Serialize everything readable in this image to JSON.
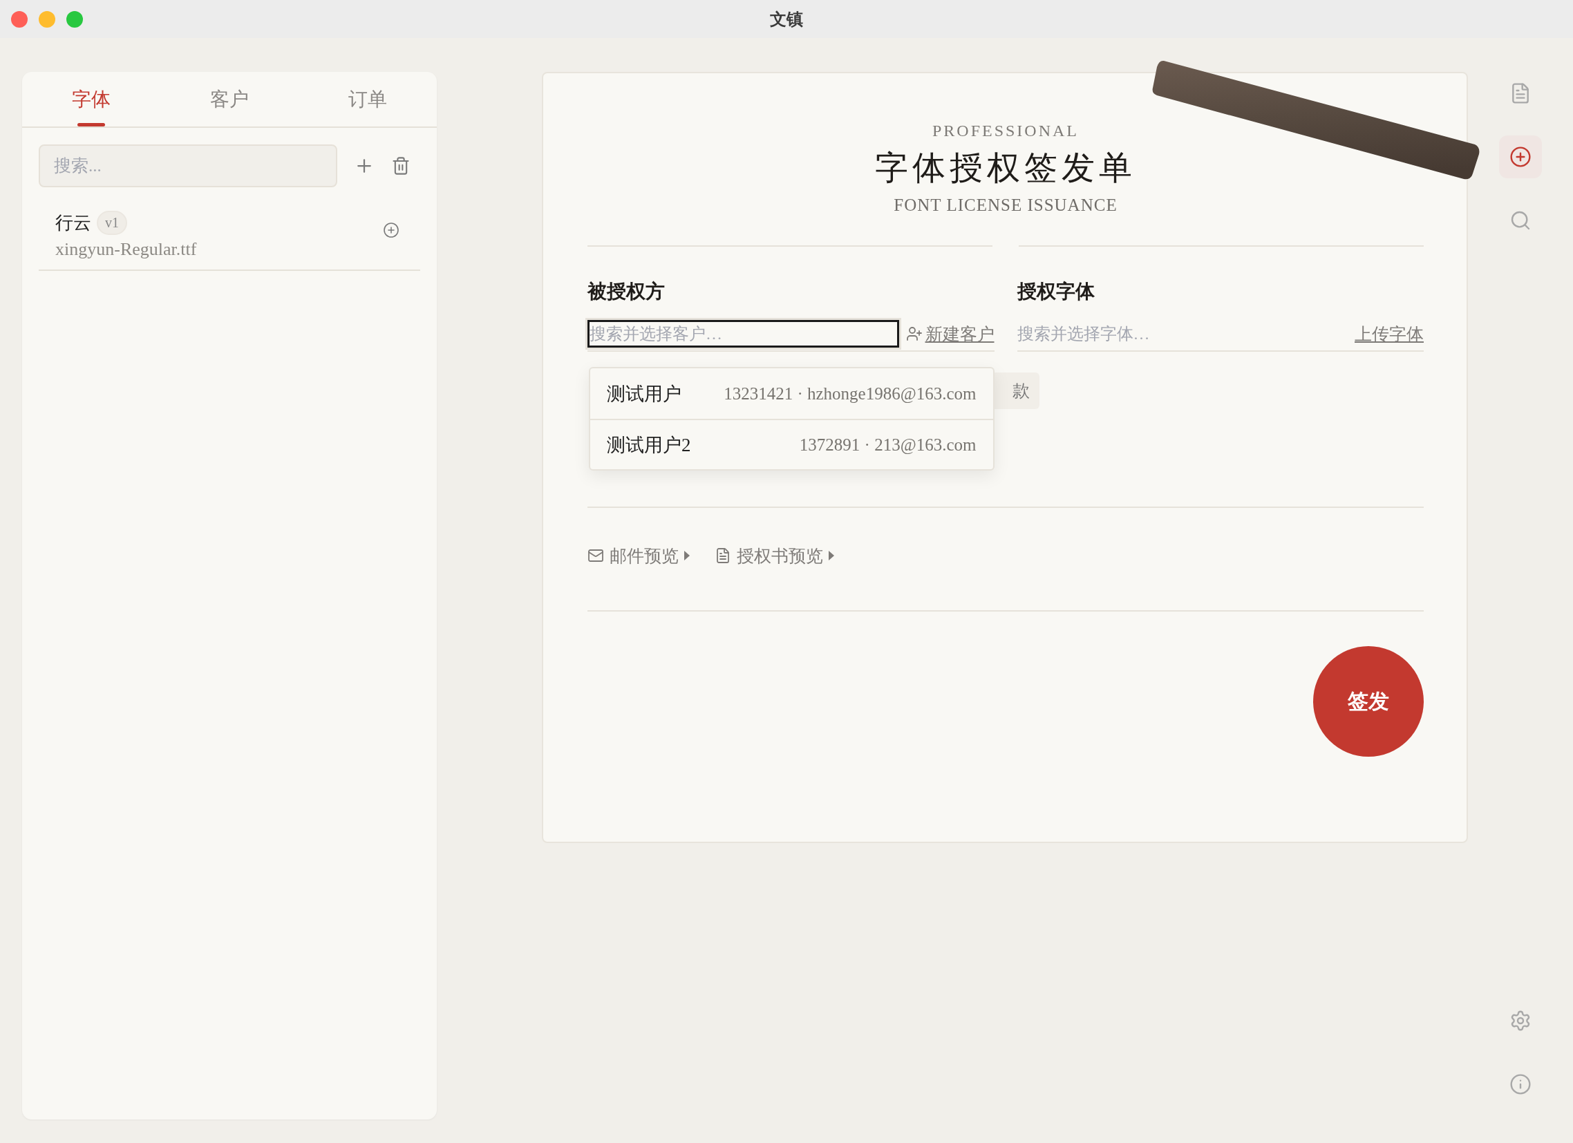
{
  "window": {
    "title": "文镇"
  },
  "sidebar": {
    "tabs": [
      {
        "label": "字体",
        "selected": true
      },
      {
        "label": "客户",
        "selected": false
      },
      {
        "label": "订单",
        "selected": false
      }
    ],
    "search": {
      "placeholder": "搜索..."
    },
    "fonts": [
      {
        "name": "行云",
        "version": "v1",
        "file": "xingyun-Regular.ttf"
      }
    ]
  },
  "form": {
    "eyebrow": "PROFESSIONAL",
    "title": "字体授权签发单",
    "subtitle": "FONT LICENSE ISSUANCE",
    "licensee": {
      "label": "被授权方",
      "placeholder": "搜索并选择客户…",
      "action": "新建客户",
      "focused": true,
      "suggestions": [
        {
          "name": "测试用户",
          "detail": "13231421 · hzhonge1986@163.com"
        },
        {
          "name": "测试用户2",
          "detail": "1372891 · 213@163.com"
        }
      ]
    },
    "font": {
      "label": "授权字体",
      "placeholder": "搜索并选择字体…",
      "action": "上传字体",
      "focused": false
    },
    "chip": {
      "label": "款"
    },
    "previews": [
      {
        "label": "邮件预览",
        "kind": "mail"
      },
      {
        "label": "授权书预览",
        "kind": "document"
      }
    ],
    "submit": "签发"
  },
  "rail": {
    "top": [
      {
        "kind": "document",
        "selected": false
      },
      {
        "kind": "new",
        "selected": true
      },
      {
        "kind": "search",
        "selected": false
      }
    ],
    "bottom": [
      {
        "kind": "settings",
        "selected": false
      },
      {
        "kind": "info",
        "selected": false
      }
    ]
  }
}
